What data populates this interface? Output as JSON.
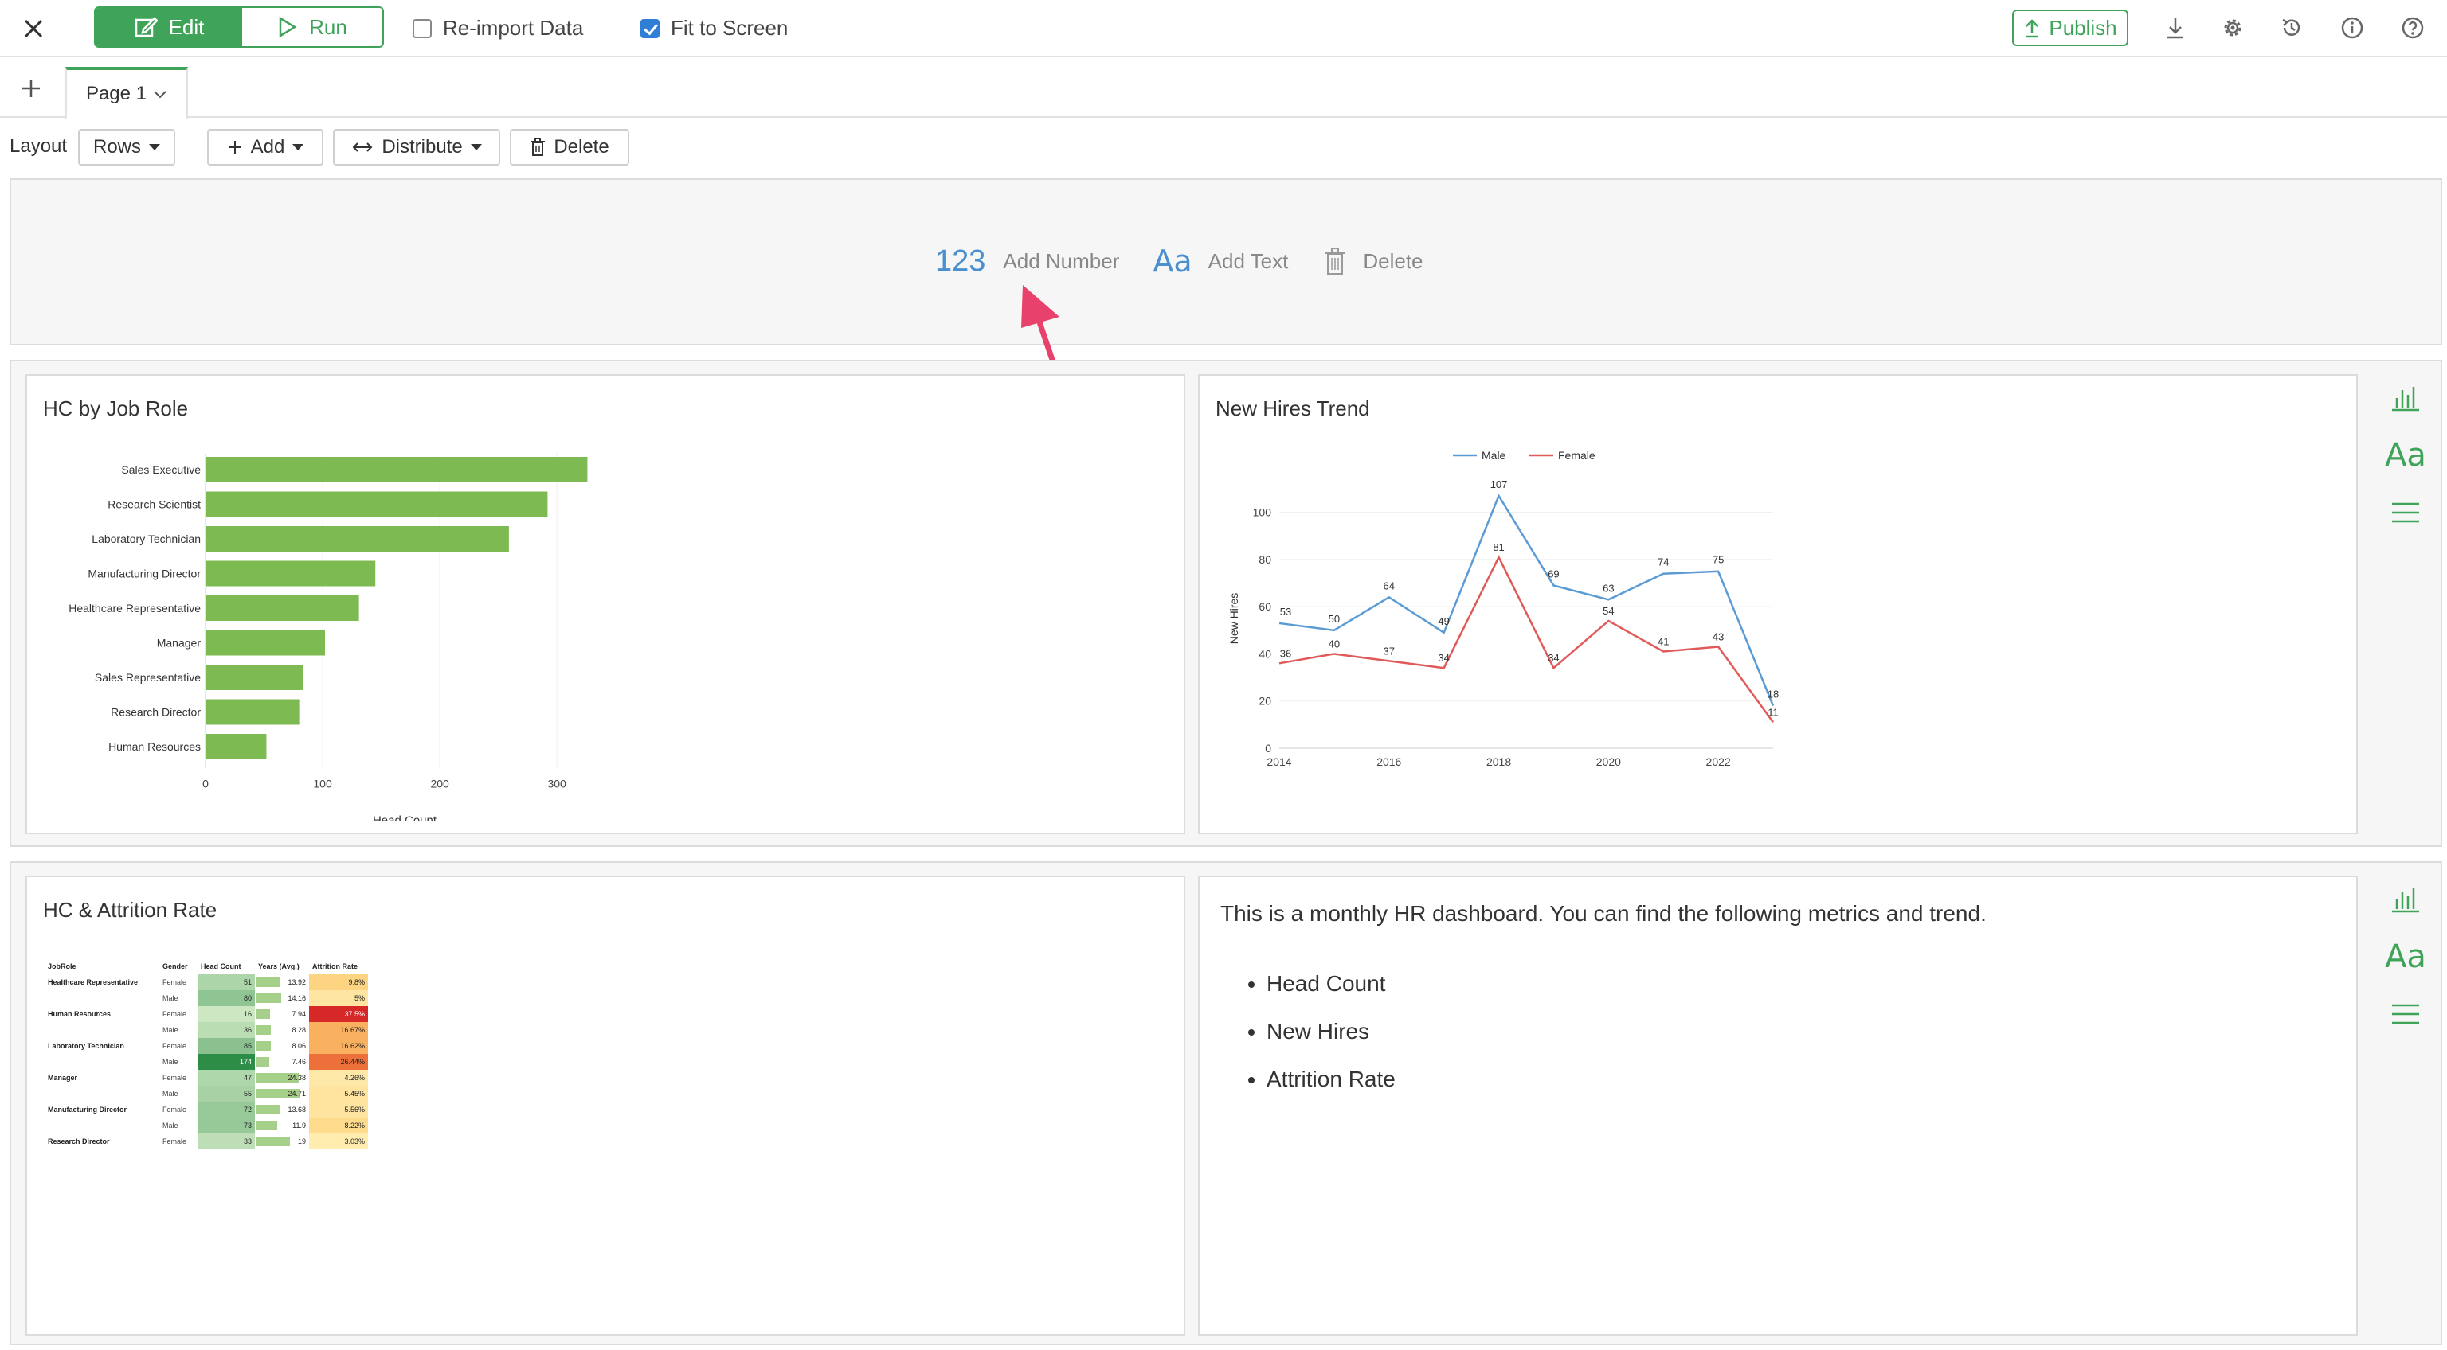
{
  "toolbar": {
    "edit_label": "Edit",
    "run_label": "Run",
    "reimport_label": "Re-import Data",
    "fit_label": "Fit to Screen",
    "publish_label": "Publish"
  },
  "tabs": [
    {
      "label": "Page 1"
    }
  ],
  "layout_bar": {
    "layout_label": "Layout",
    "rows_label": "Rows",
    "add_label": "Add",
    "distribute_label": "Distribute",
    "delete_label": "Delete"
  },
  "number_row": {
    "number_glyph": "123",
    "add_number_label": "Add Number",
    "text_glyph": "Aa",
    "add_text_label": "Add Text",
    "delete_label": "Delete"
  },
  "panels": {
    "hc_by_role_title": "HC by Job Role",
    "new_hires_title": "New Hires Trend",
    "hc_attrition_title": "HC & Attrition Rate",
    "side_text_glyph": "Aa"
  },
  "text_panel": {
    "description": "This is a monthly HR dashboard. You can find the following metrics and trend.",
    "bullets": [
      "Head Count",
      "New Hires",
      "Attrition Rate"
    ]
  },
  "colors": {
    "accent": "#3fa45a",
    "bar": "#7dbb52",
    "male": "#5b9bd5",
    "female": "#e05a5a"
  },
  "chart_data": [
    {
      "type": "bar",
      "orientation": "horizontal",
      "categories": [
        "Sales Executive",
        "Research Scientist",
        "Laboratory Technician",
        "Manufacturing Director",
        "Healthcare Representative",
        "Manager",
        "Sales Representative",
        "Research Director",
        "Human Resources"
      ],
      "values": [
        326,
        292,
        259,
        145,
        131,
        102,
        83,
        80,
        52
      ],
      "xlabel": "Head Count",
      "xlim": [
        0,
        340
      ],
      "xticks": [
        0,
        100,
        200,
        300
      ]
    },
    {
      "type": "line",
      "x": [
        2014,
        2015,
        2016,
        2017,
        2018,
        2019,
        2020,
        2021,
        2022,
        2023
      ],
      "series": [
        {
          "name": "Male",
          "values": [
            53,
            50,
            64,
            49,
            107,
            69,
            63,
            74,
            75,
            18
          ]
        },
        {
          "name": "Female",
          "values": [
            36,
            40,
            37,
            34,
            81,
            34,
            54,
            41,
            43,
            11
          ]
        }
      ],
      "ylabel": "New Hires",
      "xlim": [
        2014,
        2023
      ],
      "ylim": [
        0,
        110
      ],
      "xticks": [
        2014,
        2016,
        2018,
        2020,
        2022
      ],
      "yticks": [
        0,
        20,
        40,
        60,
        80,
        100
      ],
      "legend": "top"
    },
    {
      "type": "table",
      "columns": [
        "JobRole",
        "Gender",
        "Head Count",
        "Years (Avg.)",
        "Attrition Rate"
      ],
      "rows": [
        {
          "role": "Healthcare Representative",
          "gender": "Female",
          "hc": "51",
          "yrs": "13.92",
          "att": "9.8%"
        },
        {
          "role": "",
          "gender": "Male",
          "hc": "80",
          "yrs": "14.16",
          "att": "5%"
        },
        {
          "role": "Human Resources",
          "gender": "Female",
          "hc": "16",
          "yrs": "7.94",
          "att": "37.5%"
        },
        {
          "role": "",
          "gender": "Male",
          "hc": "36",
          "yrs": "8.28",
          "att": "16.67%"
        },
        {
          "role": "Laboratory Technician",
          "gender": "Female",
          "hc": "85",
          "yrs": "8.06",
          "att": "16.62%"
        },
        {
          "role": "",
          "gender": "Male",
          "hc": "174",
          "yrs": "7.46",
          "att": "26.44%"
        },
        {
          "role": "Manager",
          "gender": "Female",
          "hc": "47",
          "yrs": "24.38",
          "att": "4.26%"
        },
        {
          "role": "",
          "gender": "Male",
          "hc": "55",
          "yrs": "24.71",
          "att": "5.45%"
        },
        {
          "role": "Manufacturing Director",
          "gender": "Female",
          "hc": "72",
          "yrs": "13.68",
          "att": "5.56%"
        },
        {
          "role": "",
          "gender": "Male",
          "hc": "73",
          "yrs": "11.9",
          "att": "8.22%"
        },
        {
          "role": "Research Director",
          "gender": "Female",
          "hc": "33",
          "yrs": "19",
          "att": "3.03%"
        }
      ]
    }
  ]
}
